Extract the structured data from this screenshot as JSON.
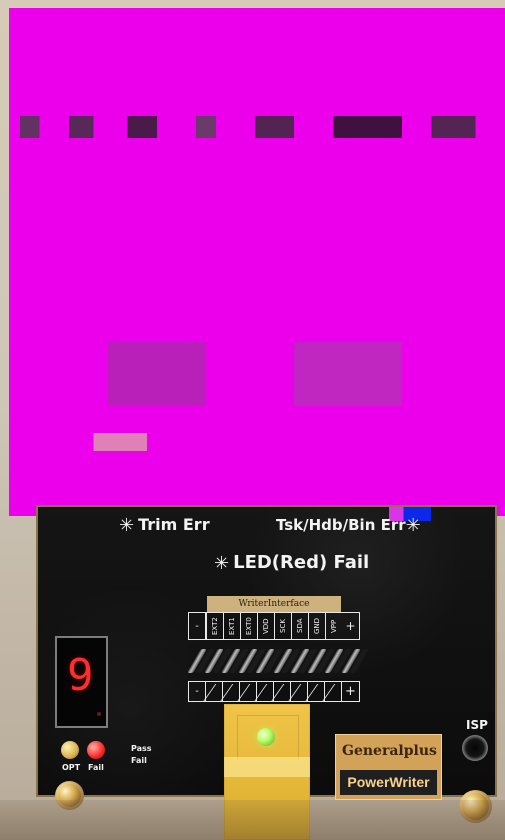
{
  "labels": {
    "trim_err": "Trim Err",
    "tsk_err": "Tsk/Hdb/Bin Err",
    "led_fail": "LED(Red) Fail",
    "writer_interface": "WriterInterface",
    "opt": "OPT",
    "fail": "Fail",
    "pass": "Pass",
    "fail_small": "Fail",
    "isp": "ISP",
    "brand_top": "Generalplus",
    "brand_bottom": "PowerWriter",
    "display_digit": "9"
  },
  "header_pins": [
    "-",
    "EXT2",
    "EXT1",
    "EXT0",
    "VDD",
    "SCK",
    "SDA",
    "GND",
    "VPP",
    "+"
  ],
  "footer_pins": [
    "-",
    "",
    "",
    "",
    "",
    "",
    "",
    "",
    "",
    "+"
  ],
  "icons": {
    "sun": "sun-icon"
  },
  "colors": {
    "magenta": "#ec00ec",
    "board": "#101010",
    "gold": "#d1a258",
    "socket": "#dcae2d",
    "led_red": "#ff2e2e",
    "led_green": "#b3ff65"
  }
}
